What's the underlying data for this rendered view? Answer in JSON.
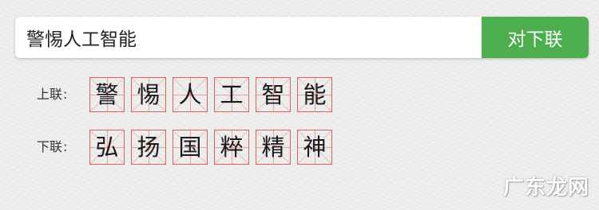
{
  "search": {
    "value": "警惕人工智能",
    "button_label": "对下联"
  },
  "upper": {
    "label": "上联",
    "colon": ":",
    "chars": [
      "警",
      "惕",
      "人",
      "工",
      "智",
      "能"
    ]
  },
  "lower": {
    "label": "下联",
    "colon": ":",
    "chars": [
      "弘",
      "扬",
      "国",
      "粹",
      "精",
      "神"
    ]
  },
  "watermark": "广东龙网",
  "colors": {
    "accent": "#4cae4c",
    "grid_line": "#e06060",
    "background": "#ececec"
  }
}
